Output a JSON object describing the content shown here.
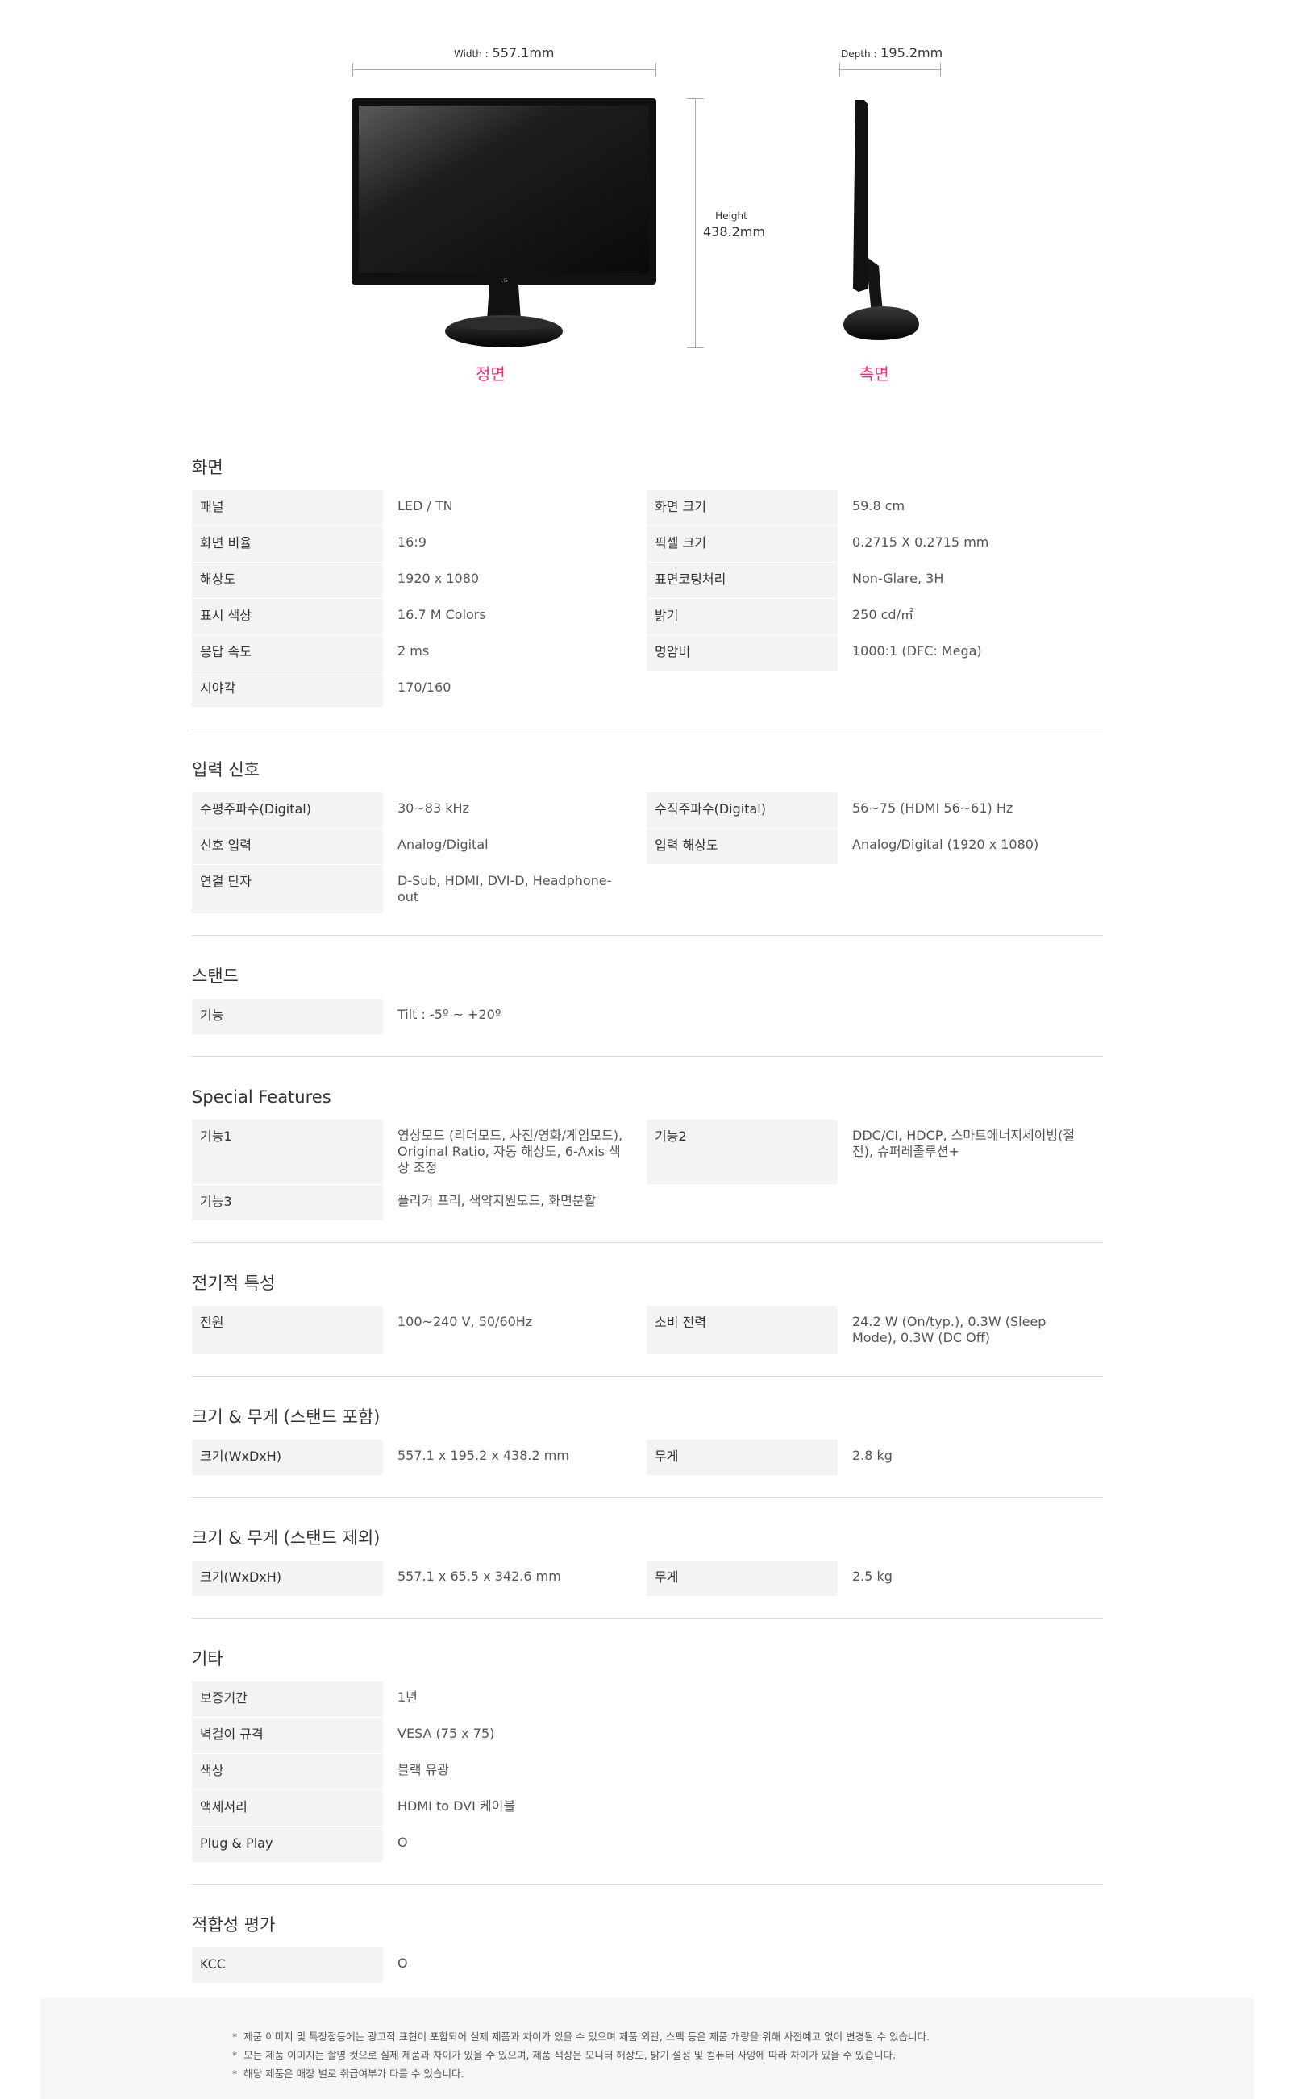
{
  "dimensions": {
    "width_label": "Width :",
    "width_value": "557.1mm",
    "depth_label": "Depth :",
    "depth_value": "195.2mm",
    "height_label": "Height",
    "height_value": "438.2mm",
    "front_label": "정면",
    "side_label": "측면"
  },
  "sections": [
    {
      "title": "화면",
      "rows": [
        [
          "패널",
          "LED / TN",
          "화면 크기",
          "59.8 cm"
        ],
        [
          "화면 비율",
          "16:9",
          "픽셀 크기",
          "0.2715 X 0.2715 mm"
        ],
        [
          "해상도",
          "1920 x 1080",
          "표면코팅처리",
          "Non-Glare, 3H"
        ],
        [
          "표시 색상",
          "16.7 M Colors",
          "밝기",
          "250 cd/㎡"
        ],
        [
          "응답 속도",
          "2 ms",
          "명암비",
          "1000:1 (DFC: Mega)"
        ],
        [
          "시야각",
          "170/160",
          "",
          ""
        ]
      ]
    },
    {
      "title": "입력 신호",
      "rows": [
        [
          "수평주파수(Digital)",
          "30~83 kHz",
          "수직주파수(Digital)",
          "56~75 (HDMI 56~61) Hz"
        ],
        [
          "신호 입력",
          "Analog/Digital",
          "입력 해상도",
          "Analog/Digital (1920 x 1080)"
        ],
        [
          "연결 단자",
          "D-Sub, HDMI, DVI-D, Headphone-out",
          "",
          ""
        ]
      ]
    },
    {
      "title": "스탠드",
      "rows": [
        [
          "기능",
          "Tilt : -5º ~ +20º",
          "",
          ""
        ]
      ]
    },
    {
      "title": "Special Features",
      "rows": [
        [
          "기능1",
          "영상모드 (리더모드, 사진/영화/게임모드), Original Ratio, 자동 해상도, 6-Axis 색상 조정",
          "기능2",
          "DDC/CI, HDCP, 스마트에너지세이빙(절전), 슈퍼레졸루션+"
        ],
        [
          "기능3",
          "플리커 프리, 색약지원모드, 화면분할",
          "",
          ""
        ]
      ]
    },
    {
      "title": "전기적 특성",
      "rows": [
        [
          "전원",
          "100~240 V, 50/60Hz",
          "소비 전력",
          "24.2 W (On/typ.), 0.3W (Sleep Mode), 0.3W (DC Off)"
        ]
      ]
    },
    {
      "title": "크기 & 무게 (스탠드 포함)",
      "rows": [
        [
          "크기(WxDxH)",
          "557.1 x 195.2 x 438.2 mm",
          "무게",
          "2.8 kg"
        ]
      ]
    },
    {
      "title": "크기 & 무게 (스탠드 제외)",
      "rows": [
        [
          "크기(WxDxH)",
          "557.1 x 65.5 x 342.6 mm",
          "무게",
          "2.5 kg"
        ]
      ]
    },
    {
      "title": "기타",
      "rows": [
        [
          "보증기간",
          "1년",
          "",
          ""
        ],
        [
          "벽걸이 규격",
          "VESA (75 x 75)",
          "",
          ""
        ],
        [
          "색상",
          "블랙 유광",
          "",
          ""
        ],
        [
          "액세서리",
          "HDMI to DVI 케이블",
          "",
          ""
        ],
        [
          "Plug & Play",
          "O",
          "",
          ""
        ]
      ]
    },
    {
      "title": "적합성 평가",
      "rows": [
        [
          "KCC",
          "O",
          "",
          ""
        ]
      ]
    }
  ],
  "footnotes": [
    "제품 이미지 및 특장점등에는 광고적 표현이 포함되어 실제 제품과 차이가 있을 수 있으며 제품 외관, 스펙 등은 제품 개량을 위해 사전예고 없이 변경될 수 있습니다.",
    "모든 제품 이미지는 촬영 컷으로 실제 제품과 차이가 있을 수 있으며, 제품 색상은 모니터 해상도, 밝기 설정 및 컴퓨터 사양에 따라 차이가 있을 수 있습니다.",
    "해당 제품은 매장 별로 취급여부가 다를 수 있습니다."
  ],
  "footnote_bullet": "*"
}
